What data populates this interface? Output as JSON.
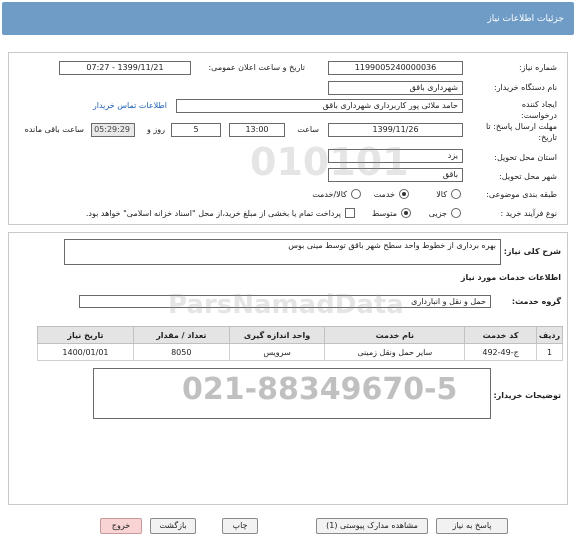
{
  "header": {
    "title": "جزئیات اطلاعات نیاز"
  },
  "form": {
    "need_number_label": "شماره نیاز:",
    "need_number": "1199005240000036",
    "announce_label": "تاریخ و ساعت اعلان عمومی:",
    "announce_value": "1399/11/21 - 07:27",
    "buyer_org_label": "نام دستگاه خریدار:",
    "buyer_org": "شهرداری باقق",
    "creator_label": "ایجاد کننده درخواست:",
    "creator": "حامد ملائی پور کاربرداری شهرداری باقق",
    "contact_link": "اطلاعات تماس خریدار",
    "deadline_label": "مهلت ارسال پاسخ: تا تاریخ:",
    "deadline_date": "1399/11/26",
    "time_label": "ساعت",
    "deadline_time": "13:00",
    "days_value": "5",
    "days_label": "روز و",
    "remaining_time": "05:29:29",
    "remaining_label": "ساعت باقی مانده",
    "province_label": "استان محل تحویل:",
    "province": "یزد",
    "city_label": "شهر محل تحویل:",
    "city": "باقق",
    "category_label": "طبقه بندی موضوعی:",
    "category_options": [
      "کالا",
      "خدمت",
      "کالا/خدمت"
    ],
    "process_label": "نوع فرآیند خرید :",
    "process_options": [
      "جزیی",
      "متوسط"
    ],
    "process_note": "پرداخت تمام یا بخشی از مبلغ خرید،از محل \"اسناد خزانه اسلامی\" خواهد بود."
  },
  "description": {
    "label": "شرح کلی نیاز:",
    "value": "بهره برداری از خطوط واحد سطح شهر باقق توسط مینی بوس"
  },
  "services": {
    "section_title": "اطلاعات خدمات مورد نیاز",
    "group_label": "گروه خدمت:",
    "group_value": "حمل و نقل و انبارداری",
    "columns": [
      "ردیف",
      "کد خدمت",
      "نام خدمت",
      "واحد اندازه گیری",
      "تعداد / مقدار",
      "تاریخ نیاز"
    ],
    "rows": [
      [
        "1",
        "ج-49-492",
        "سایر حمل ونقل زمینی",
        "سرویس",
        "8050",
        "1400/01/01"
      ]
    ]
  },
  "buyer_notes": {
    "label": "توضیحات خریدار:",
    "value": ""
  },
  "buttons": {
    "reply": "پاسخ به نیاز",
    "attachments": "مشاهده مدارک پیوستی (1)",
    "print": "چاپ",
    "back": "بازگشت",
    "exit": "خروج"
  },
  "watermark": {
    "brand": "ParsNamadData",
    "phone": "021-88349670-5",
    "number": "010101"
  },
  "colors": {
    "header_bg": "#6f9cc6",
    "link": "#1f5fb4",
    "exit_bg": "#f8d4d4"
  }
}
